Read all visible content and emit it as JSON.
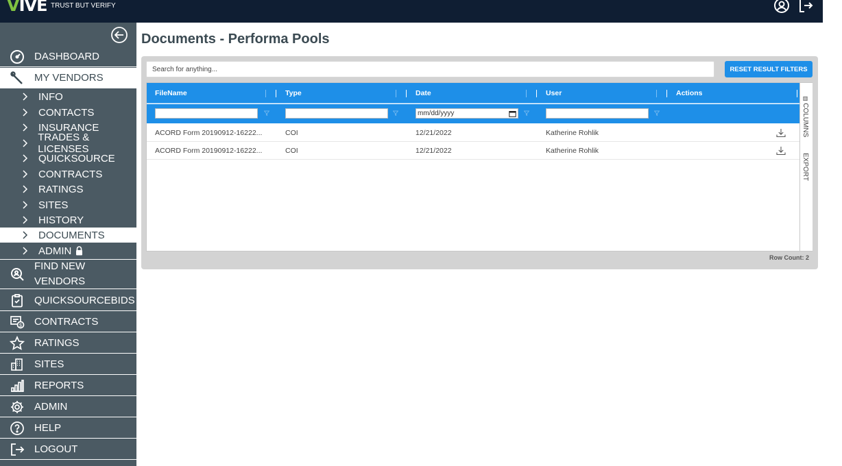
{
  "header": {
    "logo_v": "V",
    "logo_rest": "IVE",
    "tagline": "TRUST BUT VERIFY",
    "icons": {
      "profile": "user-circle-icon",
      "logout": "logout-icon"
    }
  },
  "sidebar": {
    "main_top": [
      {
        "label": "DASHBOARD",
        "icon": "gauge-icon"
      },
      {
        "label": "MY VENDORS",
        "icon": "wrench-icon"
      }
    ],
    "sub_items": [
      {
        "label": "INFO"
      },
      {
        "label": "CONTACTS"
      },
      {
        "label": "INSURANCE"
      },
      {
        "label": "TRADES & LICENSES"
      },
      {
        "label": "QUICKSOURCE"
      },
      {
        "label": "CONTRACTS"
      },
      {
        "label": "RATINGS"
      },
      {
        "label": "SITES"
      },
      {
        "label": "HISTORY"
      },
      {
        "label": "DOCUMENTS"
      },
      {
        "label": "ADMIN"
      }
    ],
    "find_new_vendors": {
      "line1": "FIND NEW",
      "line2": "VENDORS",
      "icon": "search-person-icon"
    },
    "main_bottom": [
      {
        "label": "QUICKSOURCEBIDS",
        "icon": "clipboard-icon"
      },
      {
        "label": "CONTRACTS",
        "icon": "contract-icon"
      },
      {
        "label": "RATINGS",
        "icon": "star-icon"
      },
      {
        "label": "SITES",
        "icon": "building-icon"
      },
      {
        "label": "REPORTS",
        "icon": "bar-chart-icon"
      },
      {
        "label": "ADMIN",
        "icon": "gear-icon"
      },
      {
        "label": "HELP",
        "icon": "help-icon"
      },
      {
        "label": "LOGOUT",
        "icon": "logout-icon"
      }
    ]
  },
  "main": {
    "title": "Documents - Performa Pools",
    "search_placeholder": "Search for anything...",
    "reset_label": "RESET RESULT FILTERS",
    "columns": [
      "FileName",
      "Type",
      "Date",
      "User",
      "Actions"
    ],
    "date_placeholder": "mm/dd/yyyy",
    "rows": [
      {
        "filename": "ACORD Form 20190912-16222...",
        "type": "COI",
        "date": "12/21/2022",
        "user": "Katherine Rohlik"
      },
      {
        "filename": "ACORD Form 20190912-16222...",
        "type": "COI",
        "date": "12/21/2022",
        "user": "Katherine Rohlik"
      }
    ],
    "side_tabs": [
      "COLUMNS",
      "EXPORT"
    ],
    "row_count": "Row Count: 2"
  }
}
